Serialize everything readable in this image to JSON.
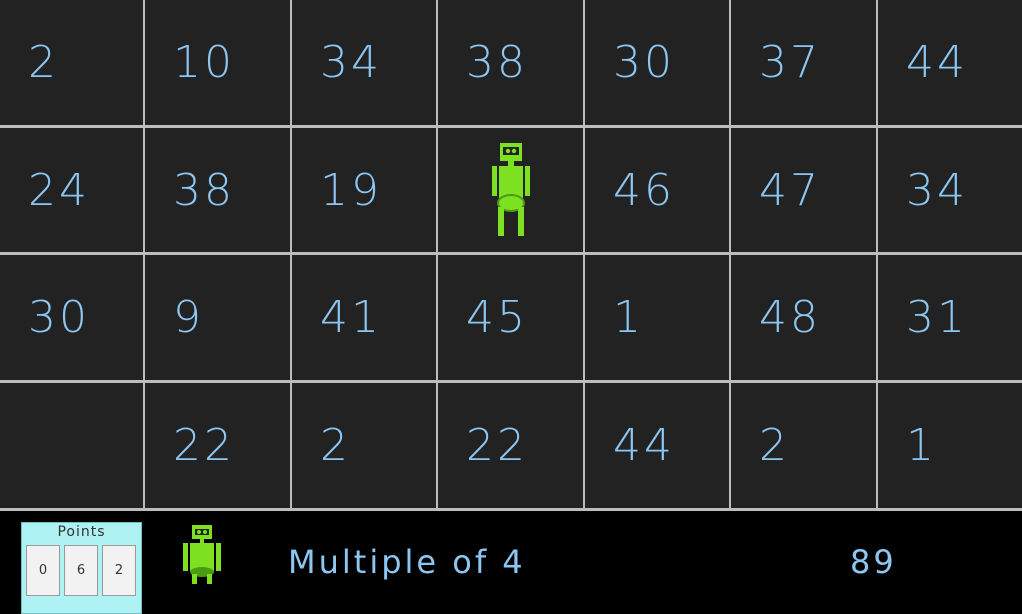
{
  "board": {
    "rows": [
      [
        "2",
        "10",
        "34",
        "38",
        "30",
        "37",
        "44"
      ],
      [
        "24",
        "38",
        "19",
        "",
        "46",
        "47",
        "34"
      ],
      [
        "30",
        "9",
        "41",
        "45",
        "1",
        "48",
        "31"
      ],
      [
        "",
        "22",
        "2",
        "22",
        "44",
        "2",
        "1"
      ]
    ],
    "player_cell": {
      "row": 1,
      "col": 3,
      "icon": "robot-icon"
    }
  },
  "hud": {
    "points_label": "Points",
    "points_digits": [
      "0",
      "6",
      "2"
    ],
    "target_rule": "Multiple of 4",
    "timer": "89",
    "lives_icon": "robot-icon"
  },
  "colors": {
    "cell_bg": "#222222",
    "grid_line": "#bdbdbd",
    "number_text": "#8cc6f2",
    "robot": "#7de020",
    "points_panel": "#aef2f4"
  }
}
